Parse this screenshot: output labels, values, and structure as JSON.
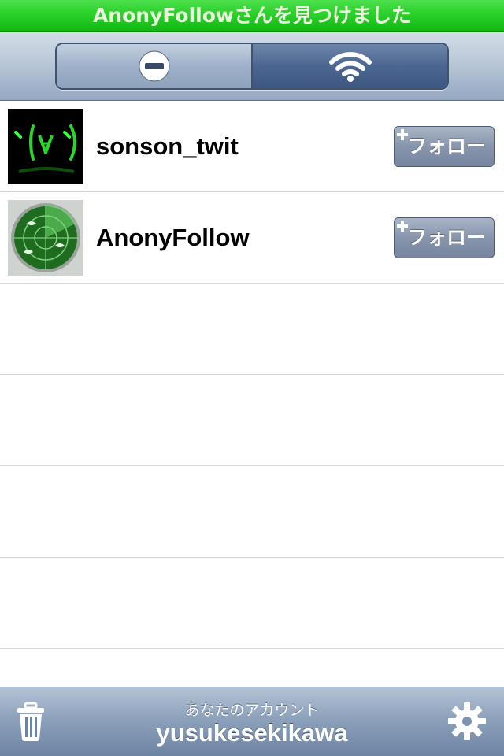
{
  "status_banner": {
    "text": "AnonyFollowさんを見つけました"
  },
  "toolbar": {
    "segments": [
      {
        "icon": "minus-circle-icon",
        "selected": false
      },
      {
        "icon": "wifi-icon",
        "selected": true
      }
    ]
  },
  "users": [
    {
      "name": "sonson_twit",
      "follow_label": "フォロー",
      "avatar": "kaomoji-avatar"
    },
    {
      "name": "AnonyFollow",
      "follow_label": "フォロー",
      "avatar": "radar-avatar"
    }
  ],
  "bottom_bar": {
    "caption": "あなたのアカウント",
    "account_name": "yusukesekikawa",
    "left_icon": "trash-icon",
    "right_icon": "gear-icon"
  },
  "colors": {
    "banner_green": "#2fd42f",
    "toolbar_blue": "#94a8c1",
    "segment_selected": "#4b6691",
    "follow_button": "#8795ad"
  }
}
